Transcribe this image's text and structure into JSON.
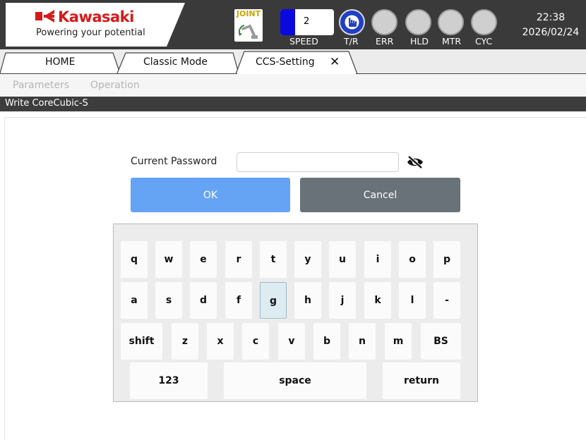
{
  "header": {
    "brand": "Kawasaki",
    "tagline": "Powering your potential",
    "joint_label": "JOINT",
    "speed": {
      "value": "2",
      "fill_fraction": 0.27,
      "label": "SPEED"
    },
    "lamps": [
      {
        "label": "T/R",
        "state": "active"
      },
      {
        "label": "ERR",
        "state": "off"
      },
      {
        "label": "HLD",
        "state": "off"
      },
      {
        "label": "MTR",
        "state": "off"
      },
      {
        "label": "CYC",
        "state": "off"
      }
    ],
    "time": "22:38",
    "date": "2026/02/24"
  },
  "tabs": [
    {
      "label": "HOME"
    },
    {
      "label": "Classic Mode"
    },
    {
      "label": "CCS-Setting",
      "active": true,
      "closable": true
    }
  ],
  "menu": [
    "Parameters",
    "Operation"
  ],
  "section_title": "Write CoreCubic-S",
  "form": {
    "password_label": "Current Password",
    "password_value": "",
    "ok_label": "OK",
    "cancel_label": "Cancel"
  },
  "keyboard": {
    "row1": [
      "q",
      "w",
      "e",
      "r",
      "t",
      "y",
      "u",
      "i",
      "o",
      "p"
    ],
    "row2": [
      "a",
      "s",
      "d",
      "f",
      "g",
      "h",
      "j",
      "k",
      "l",
      "-"
    ],
    "row3": [
      "shift",
      "z",
      "x",
      "c",
      "v",
      "b",
      "n",
      "m",
      "BS"
    ],
    "row4": [
      "123",
      "space",
      "return"
    ],
    "pressed_key": "g"
  },
  "colors": {
    "brand_red": "#d61a1a",
    "ok_blue": "#65a3f5",
    "cancel_gray": "#697278",
    "tr_lamp_blue": "#1f3fc4",
    "header_bg": "#3a3a3a"
  }
}
